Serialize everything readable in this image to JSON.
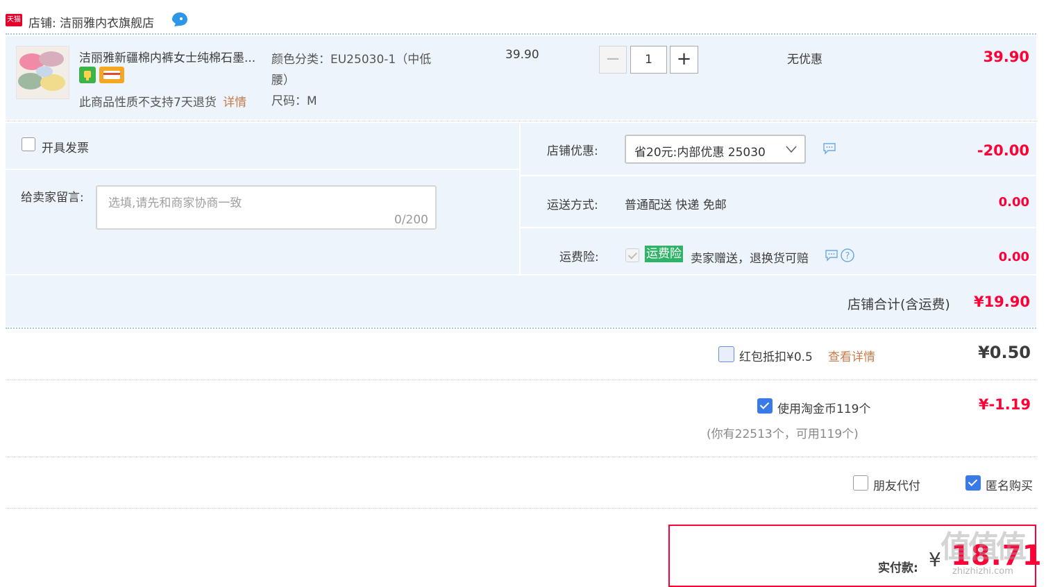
{
  "shop": {
    "tmall_badge": "天猫",
    "label": "店铺:",
    "name": "洁丽雅内衣旗舰店"
  },
  "item": {
    "title": "洁丽雅新疆棉内裤女士纯棉石墨...",
    "no_return_note": "此商品性质不支持7天退货",
    "detail_link": "详情",
    "attr_color": "颜色分类：EU25030-1（中低",
    "attr_color_cont": "腰）",
    "attr_size": "尺码：M",
    "unit_price": "39.90",
    "quantity": "1",
    "discount": "无优惠",
    "subtotal": "39.90"
  },
  "invoice": {
    "label": "开具发票"
  },
  "message": {
    "label": "给卖家留言:",
    "placeholder": "选填,请先和商家协商一致",
    "counter": "0/200"
  },
  "shop_discount": {
    "label": "店铺优惠:",
    "selected": "省20元:内部优惠 25030",
    "amount": "-20.00"
  },
  "shipping": {
    "label": "运送方式:",
    "value": "普通配送 快递 免邮",
    "amount": "0.00"
  },
  "insurance": {
    "label": "运费险:",
    "tag": "运费险",
    "text": "卖家赠送，退换货可赔",
    "amount": "0.00"
  },
  "shop_total": {
    "label": "店铺合计(含运费)",
    "amount": "¥19.90"
  },
  "red_packet": {
    "label": "红包抵扣¥0.5",
    "link": "查看详情",
    "amount": "¥0.50",
    "checked": false
  },
  "tao_coin": {
    "label": "使用淘金币119个",
    "note": "(你有22513个，可用119个)",
    "amount": "¥-1.19",
    "checked": true
  },
  "options": {
    "friend_pay": "朋友代付",
    "anonymous": "匿名购买"
  },
  "payment": {
    "label": "实付款:",
    "currency": "¥",
    "amount": "18.71"
  },
  "watermark": "值值值",
  "watermark_sub": "zhizhizhi.com",
  "colors": {
    "price_red": "#ff0036",
    "panel_blue": "#eef4fb",
    "link_orange": "#c87b4b",
    "checkbox_blue": "#3a7ae8",
    "insurance_green": "#2fb366"
  }
}
